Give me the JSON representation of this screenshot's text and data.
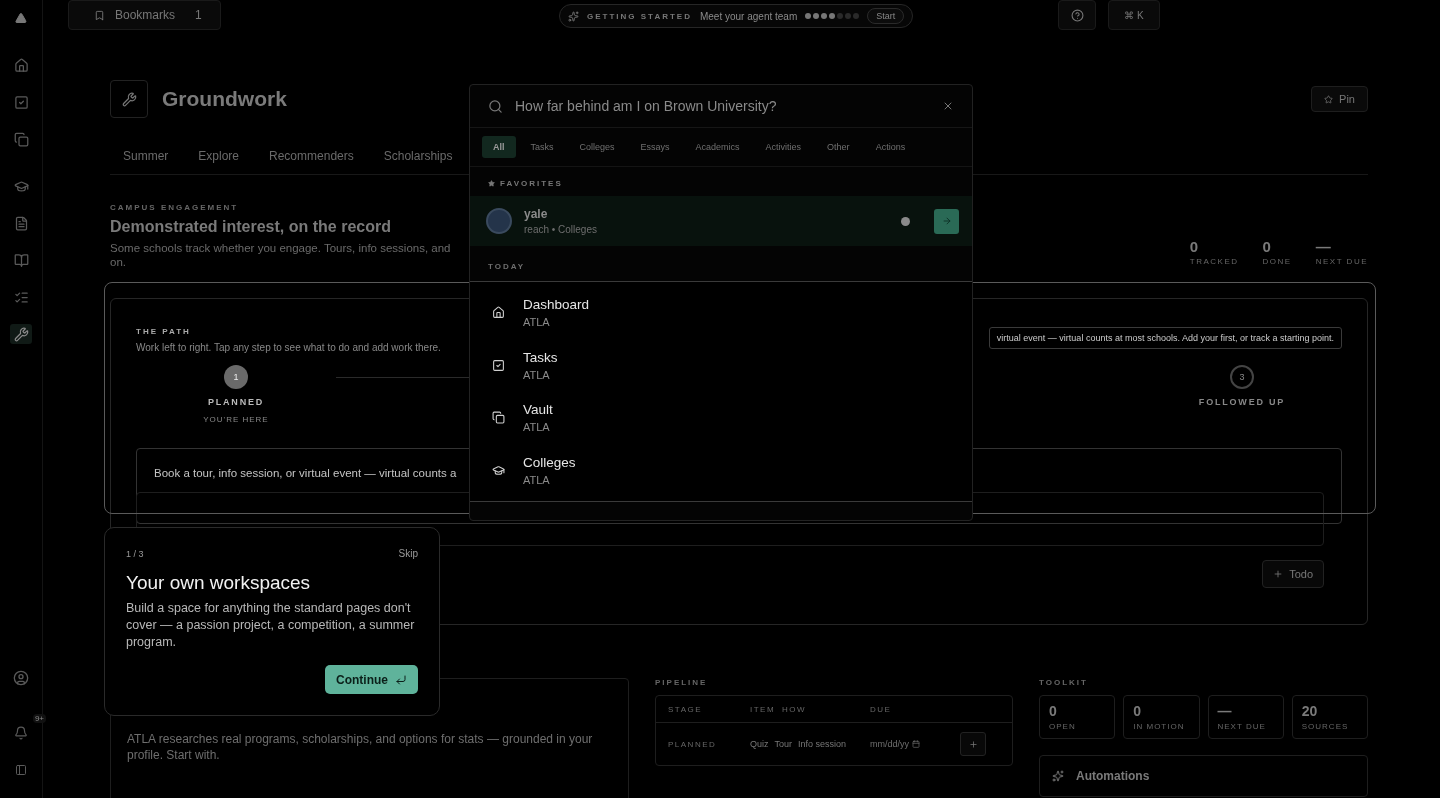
{
  "topbar": {
    "bookmarks": {
      "label": "Bookmarks",
      "count": "1"
    },
    "getting_started": {
      "kicker": "GETTING STARTED",
      "title": "Meet your agent team",
      "steps": [
        {
          "done": true
        },
        {
          "done": true
        },
        {
          "done": true
        },
        {
          "done": true
        },
        {
          "done": false
        },
        {
          "done": false
        },
        {
          "done": false
        }
      ],
      "start": "Start"
    },
    "shortcut": "⌘ K"
  },
  "sidebar": {
    "items": [
      {
        "kind": "home",
        "selected": false
      },
      {
        "kind": "tasks",
        "selected": false
      },
      {
        "kind": "vault",
        "selected": false
      },
      {
        "kind": "colleges",
        "selected": false
      },
      {
        "kind": "essays",
        "selected": false
      },
      {
        "kind": "activities",
        "selected": false
      },
      {
        "kind": "lists",
        "selected": false
      },
      {
        "kind": "tools",
        "selected": true
      }
    ],
    "notifications": "9+"
  },
  "header": {
    "title": "Groundwork",
    "pin": "Pin"
  },
  "tabs": [
    {
      "label": "Summer"
    },
    {
      "label": "Explore"
    },
    {
      "label": "Recommenders"
    },
    {
      "label": "Scholarships"
    }
  ],
  "section": {
    "kicker": "CAMPUS ENGAGEMENT",
    "title": "Demonstrated interest, on the record",
    "lines": [
      "Some schools track whether you engage. Tours, info sessions, and",
      "on."
    ]
  },
  "stats": [
    {
      "value": "0",
      "label": "TRACKED"
    },
    {
      "value": "0",
      "label": "DONE"
    },
    {
      "value": "—",
      "label": "NEXT DUE"
    }
  ],
  "path": {
    "kicker": "THE PATH",
    "hint": "Work left to right. Tap any step to see what to do and add work there.",
    "steps": [
      {
        "number": "1",
        "label": "PLANNED",
        "note": "YOU'RE HERE",
        "current": true
      },
      {
        "number": "3",
        "label": "FOLLOWED UP",
        "current": false
      }
    ],
    "tip": "virtual event — virtual counts at most schools. Add your first, or track a starting point.",
    "prompt": "Book a tour, info session, or virtual event — virtual counts a",
    "add": "Todo"
  },
  "research": {
    "text": "ATLA researches real programs, scholarships, and options for stats — grounded in your profile. Start with."
  },
  "pipeline": {
    "title": "PIPELINE",
    "columns": [
      "STAGE",
      "ITEM",
      "HOW",
      "DUE"
    ],
    "rows": [
      {
        "stage": "PLANNED",
        "options": [
          "Quiz",
          "Tour",
          "Info session"
        ],
        "due": "mm/dd/yy"
      }
    ]
  },
  "toolkit": {
    "title": "TOOLKIT",
    "stats": [
      {
        "value": "0",
        "label": "OPEN"
      },
      {
        "value": "0",
        "label": "IN MOTION"
      },
      {
        "value": "—",
        "label": "NEXT DUE"
      },
      {
        "value": "20",
        "label": "SOURCES"
      }
    ],
    "automations": "Automations"
  },
  "palette": {
    "query": "How far behind am I on Brown University?",
    "filters": [
      {
        "label": "All",
        "selected": true
      },
      {
        "label": "Tasks",
        "selected": false
      },
      {
        "label": "Colleges",
        "selected": false
      },
      {
        "label": "Essays",
        "selected": false
      },
      {
        "label": "Academics",
        "selected": false
      },
      {
        "label": "Activities",
        "selected": false
      },
      {
        "label": "Other",
        "selected": false
      },
      {
        "label": "Actions",
        "selected": false
      }
    ],
    "favorites": {
      "title": "FAVORITES",
      "items": [
        {
          "name": "yale",
          "meta": "reach • Colleges"
        }
      ]
    },
    "today": {
      "title": "TODAY",
      "items": [
        {
          "kind": "home",
          "title": "Dashboard",
          "source": "ATLA"
        },
        {
          "kind": "tasks",
          "title": "Tasks",
          "source": "ATLA"
        },
        {
          "kind": "vault",
          "title": "Vault",
          "source": "ATLA"
        },
        {
          "kind": "colleges",
          "title": "Colleges",
          "source": "ATLA"
        }
      ]
    }
  },
  "tour": {
    "counter": "1 / 3",
    "skip": "Skip",
    "title": "Your own workspaces",
    "body": "Build a space for anything the standard pages don't cover — a passion project, a competition, a summer program.",
    "action": "Continue"
  }
}
